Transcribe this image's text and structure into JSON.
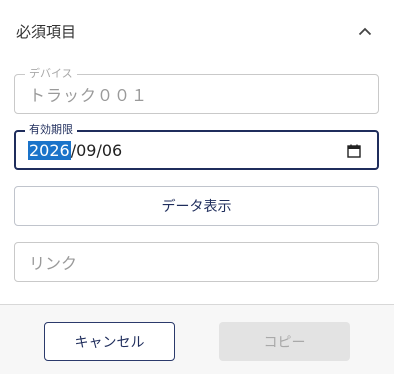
{
  "section": {
    "title": "必須項目",
    "collapse_icon": "chevron-up-icon"
  },
  "device_field": {
    "label": "デバイス",
    "value": "トラック００１"
  },
  "expiry_field": {
    "label": "有効期限",
    "year": "2026",
    "rest": "/09/06",
    "calendar_icon": "calendar-icon"
  },
  "data_display_button": {
    "label": "データ表示"
  },
  "link_field": {
    "placeholder": "リンク"
  },
  "footer": {
    "cancel_label": "キャンセル",
    "copy_label": "コピー"
  },
  "colors": {
    "accent": "#1f2d5c",
    "selection": "#1a73c9",
    "disabled_bg": "#e3e3e3"
  }
}
